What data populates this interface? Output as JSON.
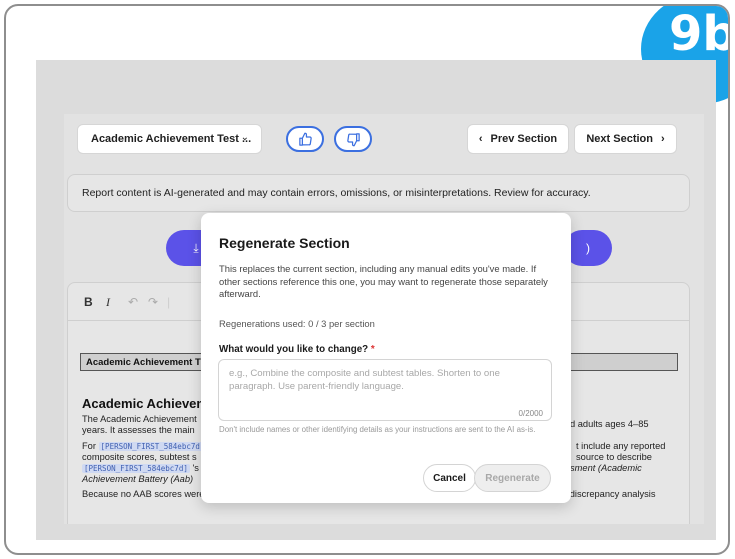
{
  "badge": "9b",
  "toolbar": {
    "section_select": "Academic Achievement Test ...",
    "prev_label": "Prev Section",
    "next_label": "Next Section"
  },
  "notice": "Report content is AI-generated and may contain errors, omissions, or misinterpretations. Review for accuracy.",
  "editor": {
    "heading_box": "Academic Achievement T",
    "section_title": "Academic Achievem",
    "p1_left": "The Academic Achievement",
    "p1_left2": "years. It assesses the main",
    "p1_right": "d adults ages 4–85",
    "p2_for": "For",
    "p2_right": "t include any reported",
    "p2_left2": "composite scores, subtest s",
    "p2_right2": "source to describe",
    "p2_tail": "'s",
    "p2_right3": "sment (Academic",
    "p2_left4": "Achievement Battery (Aab)",
    "p3_left": "Because no AAB scores were provided for",
    "p3_right": ", no qualitative interpretation, pattern analysis, or discrepancy analysis",
    "token": "[PERSON_FIRST_584ebc7d]"
  },
  "modal": {
    "title": "Regenerate Section",
    "description": "This replaces the current section, including any manual edits you've made. If other sections reference this one, you may want to regenerate those separately afterward.",
    "regenerations_used": "Regenerations used: 0 / 3 per section",
    "question": "What would you like to change?",
    "required_marker": "*",
    "placeholder": "e.g., Combine the composite and subtest tables. Shorten to one paragraph. Use parent-friendly language.",
    "value": "",
    "counter": "0/2000",
    "hint": "Don't include names or other identifying details as your instructions are sent to the AI as-is.",
    "cancel": "Cancel",
    "regenerate": "Regenerate"
  },
  "colors": {
    "accent": "#5b52e8",
    "thumb_border": "#3b6fe0",
    "badge": "#1aa3e8",
    "required": "#dd3333"
  }
}
